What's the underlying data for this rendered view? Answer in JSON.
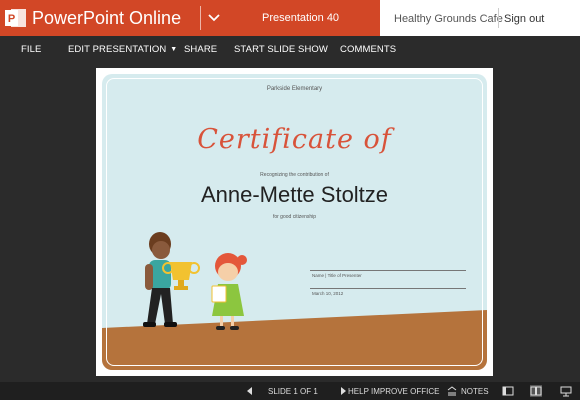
{
  "titlebar": {
    "app_name": "PowerPoint Online",
    "document_name": "Presentation 40",
    "user_name": "Healthy Grounds Cafe",
    "sign_out": "Sign out"
  },
  "ribbon": {
    "items": [
      "FILE",
      "EDIT PRESENTATION",
      "SHARE",
      "START SLIDE SHOW",
      "COMMENTS"
    ]
  },
  "slide": {
    "school": "Parkside Elementary",
    "title": "Certificate of",
    "recognizing": "Recognizing the contribution of",
    "recipient": "Anne-Mette Stoltze",
    "reason": "for good citizenship",
    "presenter_label": "Name | Title of Presenter",
    "date": "March 10, 2012"
  },
  "status": {
    "slide_indicator": "SLIDE 1 OF 1",
    "help": "HELP IMPROVE OFFICE",
    "notes": "NOTES"
  },
  "colors": {
    "brand": "#d24726",
    "ribbon": "#2b2b2b",
    "slide_background": "#d6ebee",
    "title_accent": "#d8533a",
    "ground": "#b5733c"
  },
  "icons": [
    "powerpoint-logo-icon",
    "chevron-down-icon",
    "previous-slide-icon",
    "next-slide-icon",
    "notes-icon",
    "normal-view-icon",
    "reading-view-icon",
    "slideshow-icon"
  ]
}
